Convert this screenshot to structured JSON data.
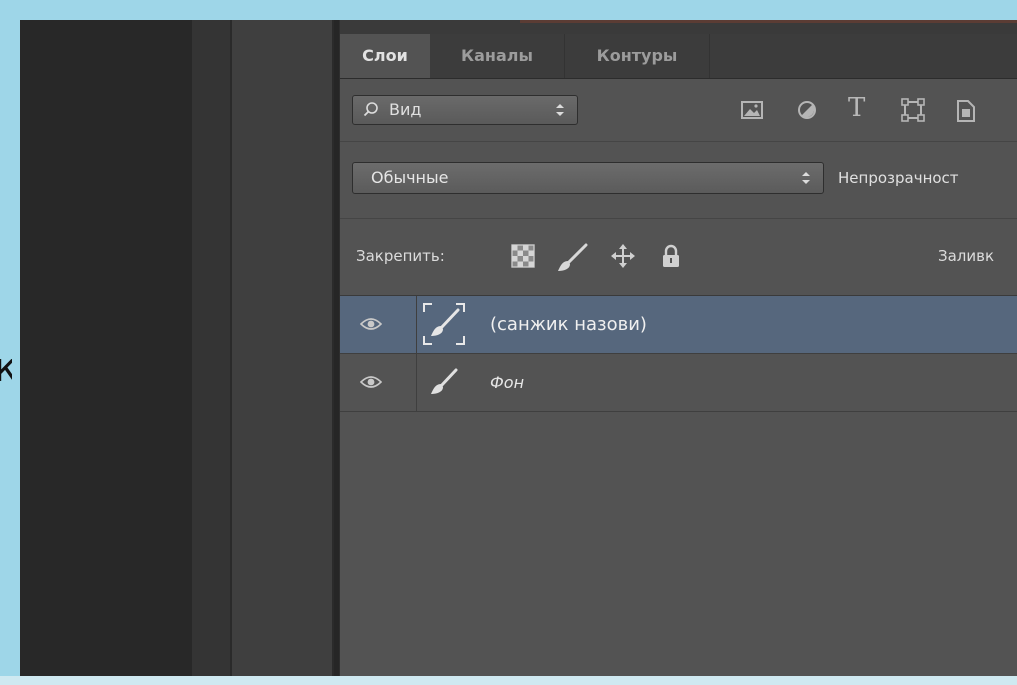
{
  "colors": {
    "frame": "#9ed6e8",
    "panel_bg": "#535353",
    "tabbar_bg": "#3c3c3c",
    "selected_row": "#56677d",
    "dark_columns": "#282828"
  },
  "edge_fragment": "к",
  "tabs": [
    {
      "label": "Слои",
      "active": true
    },
    {
      "label": "Каналы",
      "active": false
    },
    {
      "label": "Контуры",
      "active": false
    }
  ],
  "filter": {
    "icon": "search-icon",
    "value": "Вид",
    "filter_icons": [
      "pixel-layer-filter-icon",
      "adjustment-layer-filter-icon",
      "type-layer-filter-icon",
      "shape-layer-filter-icon",
      "smart-object-filter-icon"
    ],
    "type_glyph": "T"
  },
  "blend_mode": {
    "value": "Обычные",
    "opacity_label": "Непрозрачност"
  },
  "lock": {
    "label": "Закрепить:",
    "icons": [
      "lock-transparent-pixels-icon",
      "lock-image-pixels-icon",
      "lock-position-icon",
      "lock-all-icon"
    ],
    "fill_label": "Заливк"
  },
  "layers": [
    {
      "name": "(санжик назови)",
      "selected": true,
      "visible": true,
      "italic": false
    },
    {
      "name": "Фон",
      "selected": false,
      "visible": true,
      "italic": true
    }
  ]
}
